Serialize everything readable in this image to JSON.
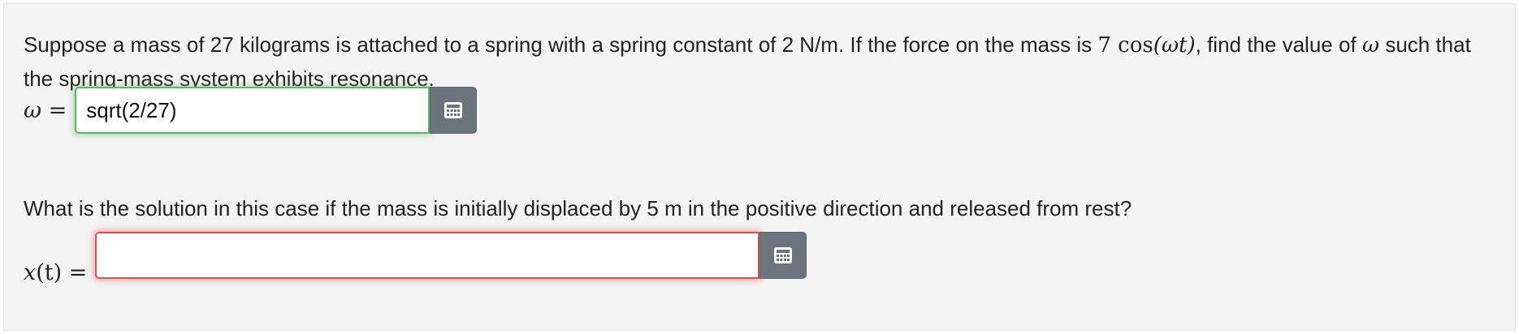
{
  "question1": {
    "text_before": "Suppose a mass of 27 kilograms is attached to a spring with a spring constant of 2 N/m. If the force on the mass is ",
    "force_number": "7",
    "force_func": " cos",
    "force_arg": "(ωt)",
    "text_middle": ", find the value of ",
    "omega_symbol": "ω",
    "text_after": " such that the spring-mass system exhibits resonance."
  },
  "answer1": {
    "lhs_var": "ω",
    "lhs_eq": " = ",
    "value": "sqrt(2/27)",
    "status": "correct",
    "status_color": "#5cb85c",
    "keypad_icon": "calculator-grid-icon"
  },
  "question2": {
    "text": "What is the solution in this case if the mass is initially displaced by 5 m in the positive direction and released from rest?"
  },
  "answer2": {
    "lhs_var": "x",
    "lhs_rest": "(t) = ",
    "value": "",
    "status": "incorrect",
    "status_color": "#d9534f",
    "keypad_icon": "calculator-grid-icon"
  }
}
